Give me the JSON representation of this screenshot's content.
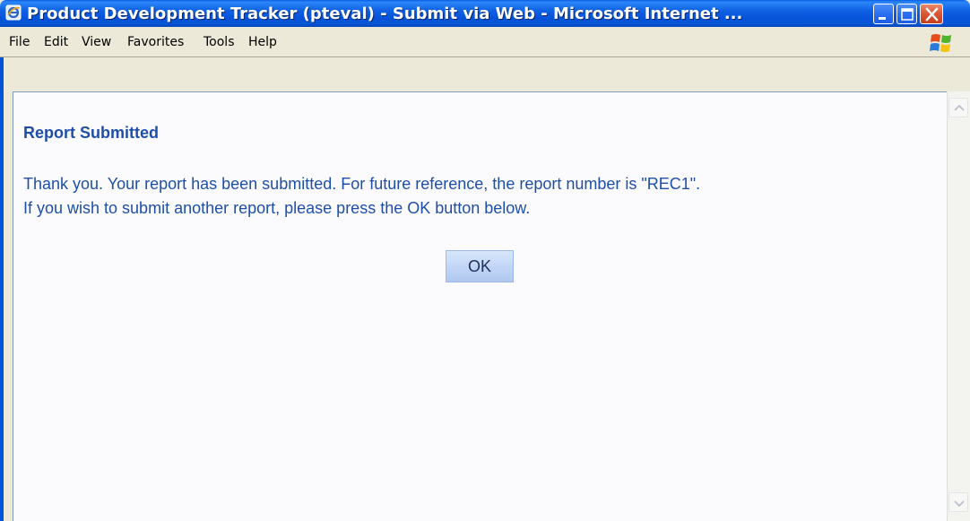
{
  "window": {
    "title": "Product Development Tracker (pteval) - Submit via Web - Microsoft Internet ...",
    "icon": "internet-explorer-icon"
  },
  "title_buttons": {
    "minimize": "minimize-icon",
    "maximize": "maximize-icon",
    "close": "close-icon"
  },
  "menu": {
    "items": [
      {
        "label": "File"
      },
      {
        "label": "Edit"
      },
      {
        "label": "View"
      },
      {
        "label": "Favorites"
      },
      {
        "label": "Tools"
      },
      {
        "label": "Help"
      }
    ],
    "logo": "windows-logo-icon"
  },
  "page": {
    "heading": "Report Submitted",
    "message_line1": "Thank you. Your report has been submitted. For future reference, the report number is \"REC1\".",
    "message_line2": "If you wish to submit another report, please press the OK button below.",
    "ok_label": "OK"
  },
  "scrollbar": {
    "up_icon": "scroll-up-arrow-icon",
    "down_icon": "scroll-down-arrow-icon"
  },
  "colors": {
    "titlebar": "#0a5ee6",
    "content_text": "#1e4fa8",
    "close_button": "#d95a37",
    "menubar": "#ece9d8"
  }
}
